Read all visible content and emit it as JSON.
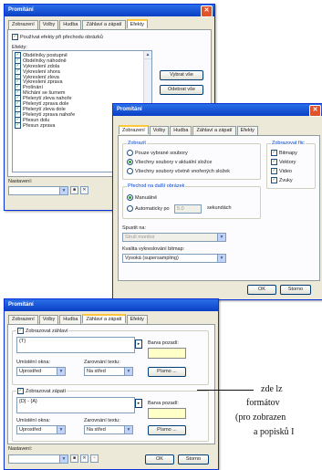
{
  "window1": {
    "title": "Promítání",
    "tabs": [
      "Zobrazení",
      "Volby",
      "Hudba",
      "Záhlaví a zápatí",
      "Efekty"
    ],
    "use_effects_label": "Používat efekty při přechodu obrázků",
    "effects_label": "Efekty:",
    "effects": [
      "Obdélníky postupně",
      "Obdélníky náhodně",
      "Vykreslení zdola",
      "Vykreslení shora",
      "Vykreslení zleva",
      "Vykreslení zprava",
      "Prolínání",
      "Míchání se šumem",
      "Přelerytí zleva nahoře",
      "Přelerytí zprava dole",
      "Přelerytí zleva dole",
      "Přelerytí zprava nahoře",
      "Přesun dolu",
      "Přesun zprava"
    ],
    "select_all": "Vybrat vše",
    "deselect_all": "Odebrat vše",
    "settings_label": "Nastavení:"
  },
  "window2": {
    "title": "Promítání",
    "tabs": [
      "Zobrazení",
      "Volby",
      "Hudba",
      "Záhlaví a zápatí",
      "Efekty"
    ],
    "show_group": "Zobrazit",
    "show_options": [
      "Pouze vybrané soubory",
      "Všechny soubory v aktuální složce",
      "Všechny soubory včetně vnořených složek"
    ],
    "transition_group": "Přechod na další obrázek",
    "manual": "Manuálně",
    "auto": "Automaticky po",
    "auto_value": "5.0",
    "seconds": "sekundách",
    "formats_group": "Zobrazovat fiic",
    "formats": [
      "Bitmapy",
      "Vektory",
      "Video",
      "Zvuky"
    ],
    "run_on": "Spustit na:",
    "run_on_value": "Strulí monitor",
    "quality_label": "Kvalita vykreslování bitmap:",
    "quality_value": "Vysoká (supersampling)",
    "ok": "OK",
    "cancel": "Storno"
  },
  "window3": {
    "title": "Promítání",
    "tabs": [
      "Zobrazení",
      "Volby",
      "Hudba",
      "Záhlaví a zápatí",
      "Efekty"
    ],
    "show_header": "Zobrazovat záhlaví",
    "header_text": "{T}",
    "bg_color_label": "Barva pozadí:",
    "window_pos_label": "Umístění okna:",
    "window_pos_value": "Uprostřed",
    "text_align_label": "Zarovnání textu:",
    "text_align_value": "Na střed",
    "font_button": "Písmo ...",
    "show_footer": "Zobrazovat zápatí",
    "footer_text": "{D} - {A}",
    "settings_label": "Nastavení:",
    "ok": "OK",
    "cancel": "Storno"
  },
  "annotation": {
    "lines": [
      "zde lz",
      "formátov",
      "(pro zobrazen",
      "a popisků I"
    ]
  }
}
